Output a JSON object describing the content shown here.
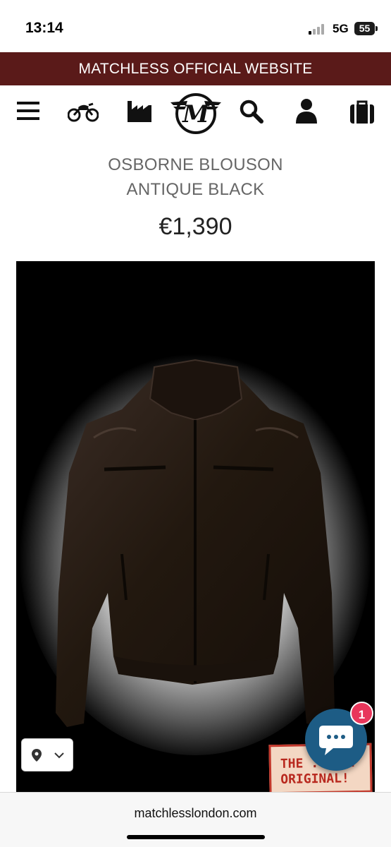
{
  "status_bar": {
    "time": "13:14",
    "network": "5G",
    "battery": "55"
  },
  "banner": {
    "text": "MATCHLESS OFFICIAL WEBSITE",
    "background_color": "#5a1a19"
  },
  "nav": {
    "items": [
      {
        "icon": "menu-icon"
      },
      {
        "icon": "motorcycle-icon"
      },
      {
        "icon": "factory-icon"
      },
      {
        "icon": "matchless-logo"
      },
      {
        "icon": "search-icon"
      },
      {
        "icon": "account-icon"
      },
      {
        "icon": "bag-icon"
      }
    ],
    "logo_letter": "M"
  },
  "product": {
    "title_line1": "OSBORNE BLOUSON",
    "title_line2": "ANTIQUE BLACK",
    "price": "€1,390"
  },
  "image_overlay": {
    "location_icon": "map-pin-icon",
    "chevron_icon": "chevron-down-icon",
    "stamp_line1": "THE ... ..",
    "stamp_line2": "ORIGINAL!"
  },
  "chat": {
    "icon": "chat-bubble-icon",
    "badge_count": "1",
    "color": "#1d5c85"
  },
  "browser": {
    "url": "matchlesslondon.com"
  }
}
